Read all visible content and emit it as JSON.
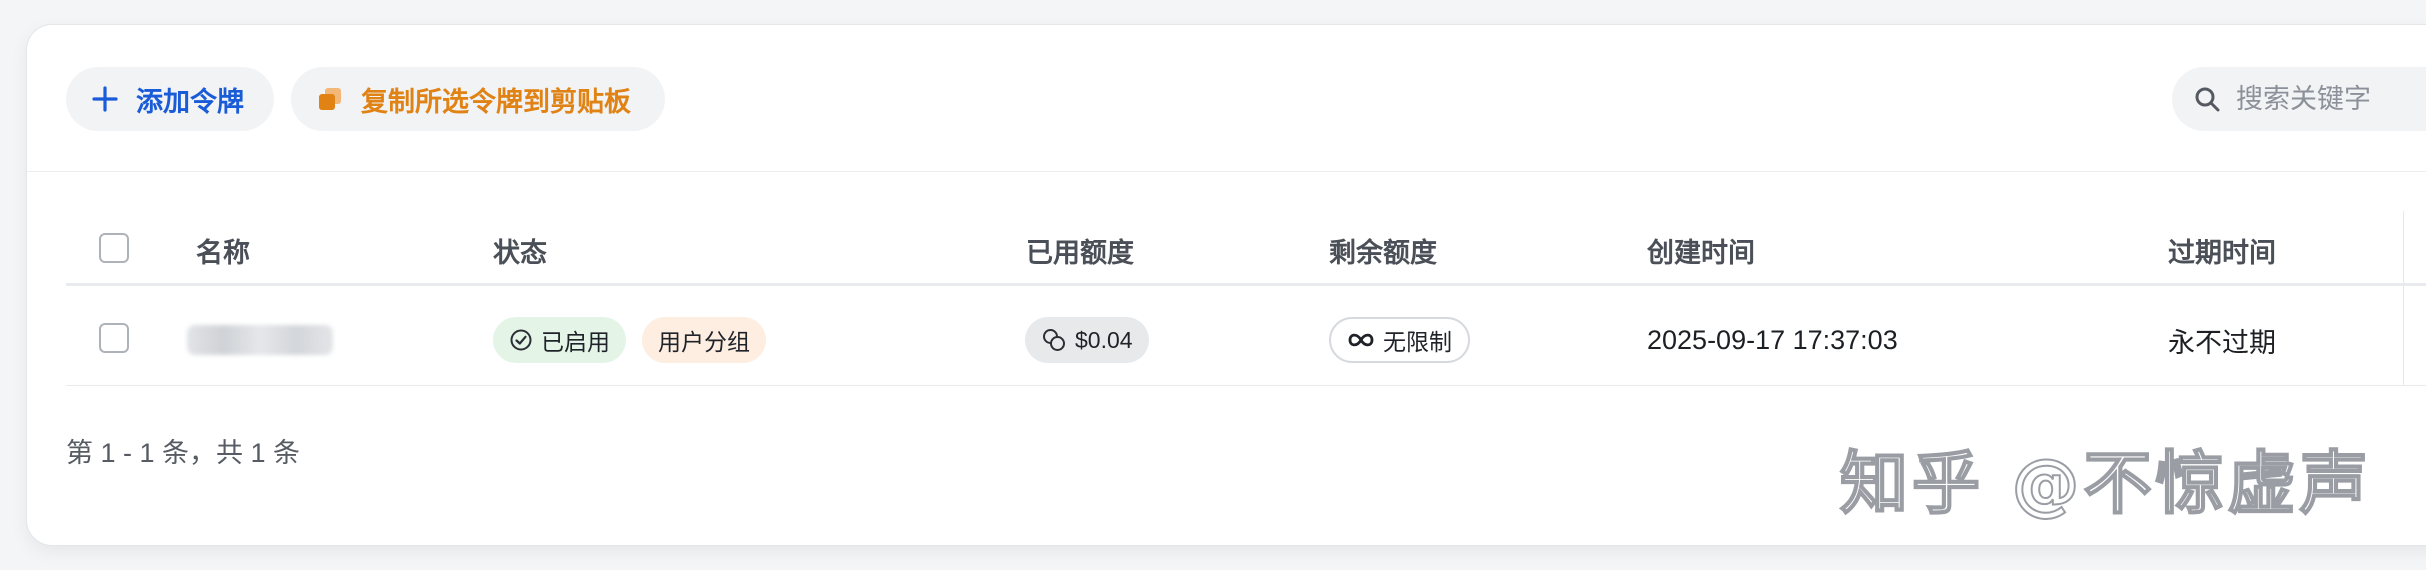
{
  "toolbar": {
    "add_label": "添加令牌",
    "copy_label": "复制所选令牌到剪贴板",
    "search_placeholder": "搜索关键字"
  },
  "table": {
    "columns": [
      "名称",
      "状态",
      "已用额度",
      "剩余额度",
      "创建时间",
      "过期时间"
    ],
    "rows": [
      {
        "name": "",
        "status": "已启用",
        "group": "用户分组",
        "used": "$0.04",
        "remaining": "无限制",
        "created": "2025-09-17 17:37:03",
        "expires": "永不过期"
      }
    ]
  },
  "pagination": {
    "summary": "第 1 - 1 条，共 1 条"
  },
  "watermark": "知乎 @不惊虚声",
  "colors": {
    "primary": "#1a5bd7",
    "warning": "#e08214",
    "status_bg": "#e4f5e8",
    "group_bg": "#fdeee1"
  }
}
